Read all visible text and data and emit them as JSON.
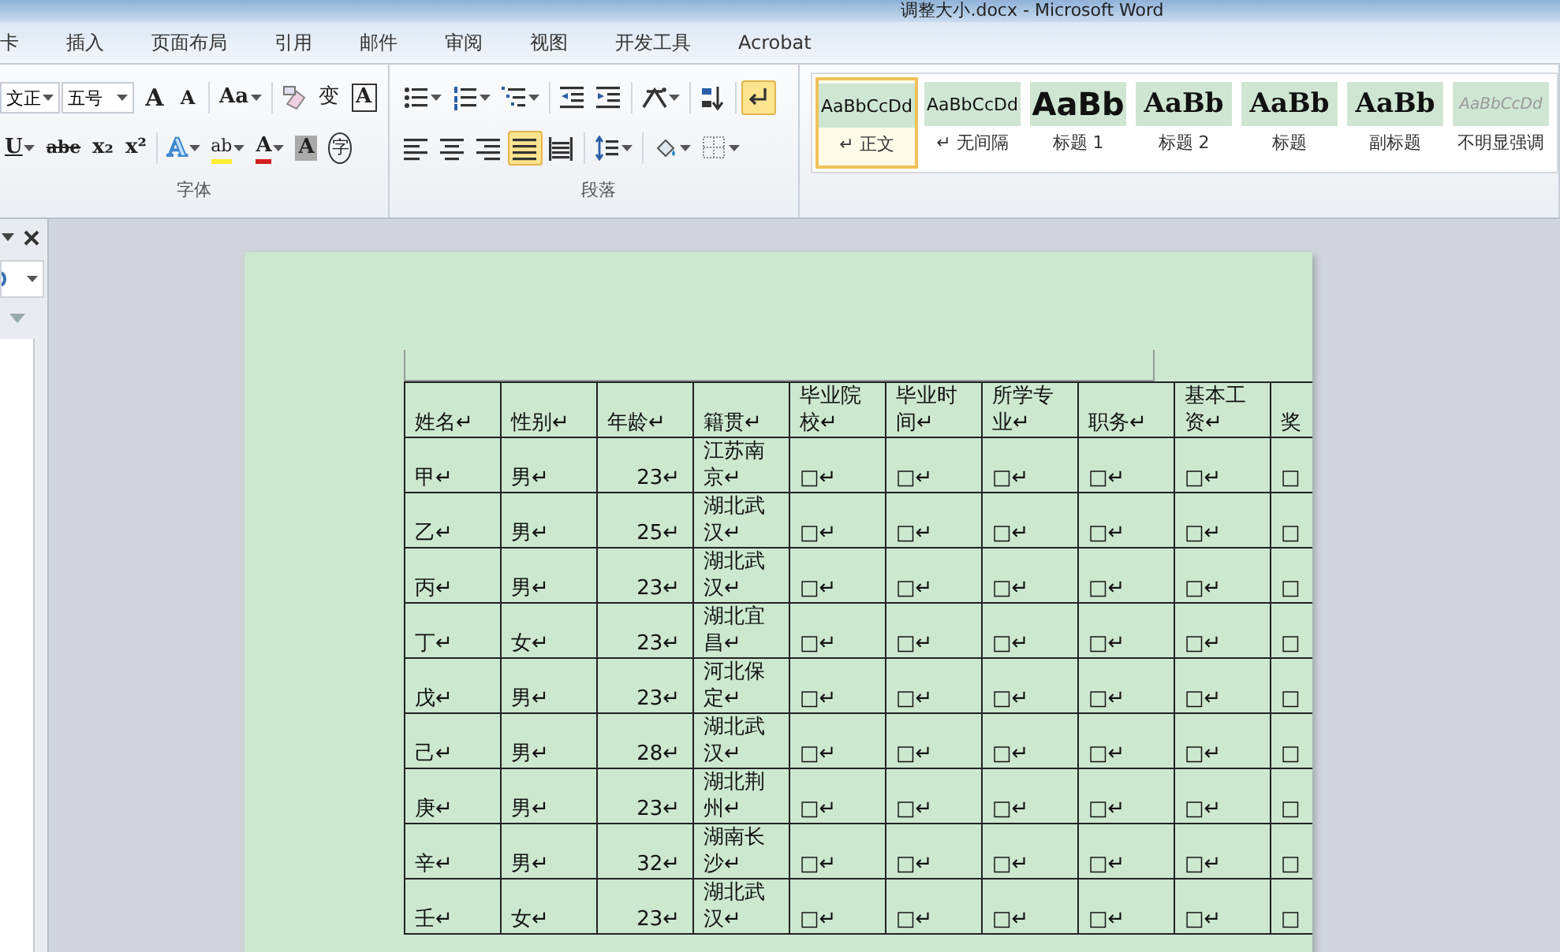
{
  "window": {
    "title": "调整大小.docx - Microsoft Word"
  },
  "tabs": [
    {
      "label": "卡"
    },
    {
      "label": "插入"
    },
    {
      "label": "页面布局"
    },
    {
      "label": "引用"
    },
    {
      "label": "邮件"
    },
    {
      "label": "审阅"
    },
    {
      "label": "视图"
    },
    {
      "label": "开发工具"
    },
    {
      "label": "Acrobat"
    }
  ],
  "ribbon": {
    "font_group": {
      "label": "字体",
      "font_name": "文正",
      "font_size": "五号",
      "rows": {
        "top": [
          {
            "kind": "grow",
            "text": "A",
            "selected": false
          },
          {
            "kind": "shrink",
            "text": "A",
            "selected": false
          },
          {
            "kind": "case",
            "text": "Aa",
            "dropdown": true,
            "selected": false
          },
          {
            "kind": "clear",
            "selected": false
          },
          {
            "kind": "phonetic",
            "text": "变",
            "selected": false
          },
          {
            "kind": "charborder",
            "text": "A",
            "selected": false
          }
        ],
        "bottom": [
          {
            "kind": "underline",
            "text": "U",
            "dropdown": true,
            "selected": false
          },
          {
            "kind": "strike",
            "text": "abe",
            "selected": false
          },
          {
            "kind": "sub",
            "text": "x₂",
            "selected": false
          },
          {
            "kind": "sup",
            "text": "x²",
            "selected": false
          },
          {
            "kind": "effect",
            "text": "A",
            "dropdown": true,
            "selected": false
          },
          {
            "kind": "highlight",
            "text": "ab",
            "dropdown": true,
            "selected": false
          },
          {
            "kind": "fontcolor",
            "text": "A",
            "dropdown": true,
            "selected": false
          },
          {
            "kind": "shade",
            "text": "A",
            "selected": false
          },
          {
            "kind": "enclose",
            "text": "字",
            "selected": false
          }
        ]
      }
    },
    "paragraph_group": {
      "label": "段落",
      "rows": {
        "top": [
          {
            "kind": "bullets",
            "dropdown": true,
            "selected": false
          },
          {
            "kind": "numbering",
            "dropdown": true,
            "selected": false
          },
          {
            "kind": "multilevel",
            "dropdown": true,
            "selected": false
          },
          {
            "kind": "outdent",
            "selected": false
          },
          {
            "kind": "indent",
            "selected": false
          },
          {
            "kind": "asian",
            "dropdown": true,
            "selected": false
          },
          {
            "kind": "sort",
            "selected": false
          },
          {
            "kind": "marks",
            "selected": true
          }
        ],
        "bottom": [
          {
            "kind": "left",
            "selected": false
          },
          {
            "kind": "center",
            "selected": false
          },
          {
            "kind": "right",
            "selected": false
          },
          {
            "kind": "justify",
            "selected": true
          },
          {
            "kind": "distributed",
            "selected": false
          },
          {
            "kind": "spacing",
            "dropdown": true,
            "selected": false
          },
          {
            "kind": "shading",
            "dropdown": true,
            "selected": false
          },
          {
            "kind": "borders",
            "dropdown": true,
            "selected": false
          }
        ]
      }
    },
    "styles": [
      {
        "kind": "body",
        "preview": "AaBbCcDd",
        "name": "↵ 正文",
        "selected": true
      },
      {
        "kind": "nospacing",
        "preview": "AaBbCcDd",
        "name": "↵ 无间隔",
        "selected": false
      },
      {
        "kind": "heading1",
        "preview": "AaBb",
        "name": "标题 1",
        "selected": false
      },
      {
        "kind": "heading2",
        "preview": "AaBb",
        "name": "标题 2",
        "selected": false
      },
      {
        "kind": "title",
        "preview": "AaBb",
        "name": "标题",
        "selected": false
      },
      {
        "kind": "subtitle",
        "preview": "AaBb",
        "name": "副标题",
        "selected": false
      },
      {
        "kind": "subtle",
        "preview": "AaBbCcDd",
        "name": "不明显强调",
        "selected": false
      }
    ]
  },
  "table": {
    "columns": [
      {
        "label": "姓名↵",
        "kind": "text"
      },
      {
        "label": "性别↵",
        "kind": "text"
      },
      {
        "label": "年龄↵",
        "kind": "number"
      },
      {
        "label": "籍贯↵",
        "kind": "text"
      },
      {
        "label": "毕业院校↵",
        "kind": "text"
      },
      {
        "label": "毕业时间↵",
        "kind": "text"
      },
      {
        "label": "所学专业↵",
        "kind": "text"
      },
      {
        "label": "职务↵",
        "kind": "text"
      },
      {
        "label": "基本工资↵",
        "kind": "text"
      },
      {
        "label": "奖",
        "kind": "text"
      }
    ],
    "rows": [
      {
        "cells": [
          "甲↵",
          "男↵",
          "23↵",
          "江苏南京↵",
          "□↵",
          "□↵",
          "□↵",
          "□↵",
          "□↵",
          "□"
        ]
      },
      {
        "cells": [
          "乙↵",
          "男↵",
          "25↵",
          "湖北武汉↵",
          "□↵",
          "□↵",
          "□↵",
          "□↵",
          "□↵",
          "□"
        ]
      },
      {
        "cells": [
          "丙↵",
          "男↵",
          "23↵",
          "湖北武汉↵",
          "□↵",
          "□↵",
          "□↵",
          "□↵",
          "□↵",
          "□"
        ]
      },
      {
        "cells": [
          "丁↵",
          "女↵",
          "23↵",
          "湖北宜昌↵",
          "□↵",
          "□↵",
          "□↵",
          "□↵",
          "□↵",
          "□"
        ]
      },
      {
        "cells": [
          "戊↵",
          "男↵",
          "23↵",
          "河北保定↵",
          "□↵",
          "□↵",
          "□↵",
          "□↵",
          "□↵",
          "□"
        ]
      },
      {
        "cells": [
          "己↵",
          "男↵",
          "28↵",
          "湖北武汉↵",
          "□↵",
          "□↵",
          "□↵",
          "□↵",
          "□↵",
          "□"
        ]
      },
      {
        "cells": [
          "庚↵",
          "男↵",
          "23↵",
          "湖北荆州↵",
          "□↵",
          "□↵",
          "□↵",
          "□↵",
          "□↵",
          "□"
        ]
      },
      {
        "cells": [
          "辛↵",
          "男↵",
          "32↵",
          "湖南长沙↵",
          "□↵",
          "□↵",
          "□↵",
          "□↵",
          "□↵",
          "□"
        ]
      },
      {
        "cells": [
          "壬↵",
          "女↵",
          "23↵",
          "湖北武汉↵",
          "□↵",
          "□↵",
          "□↵",
          "□↵",
          "□↵",
          "□"
        ]
      }
    ]
  }
}
